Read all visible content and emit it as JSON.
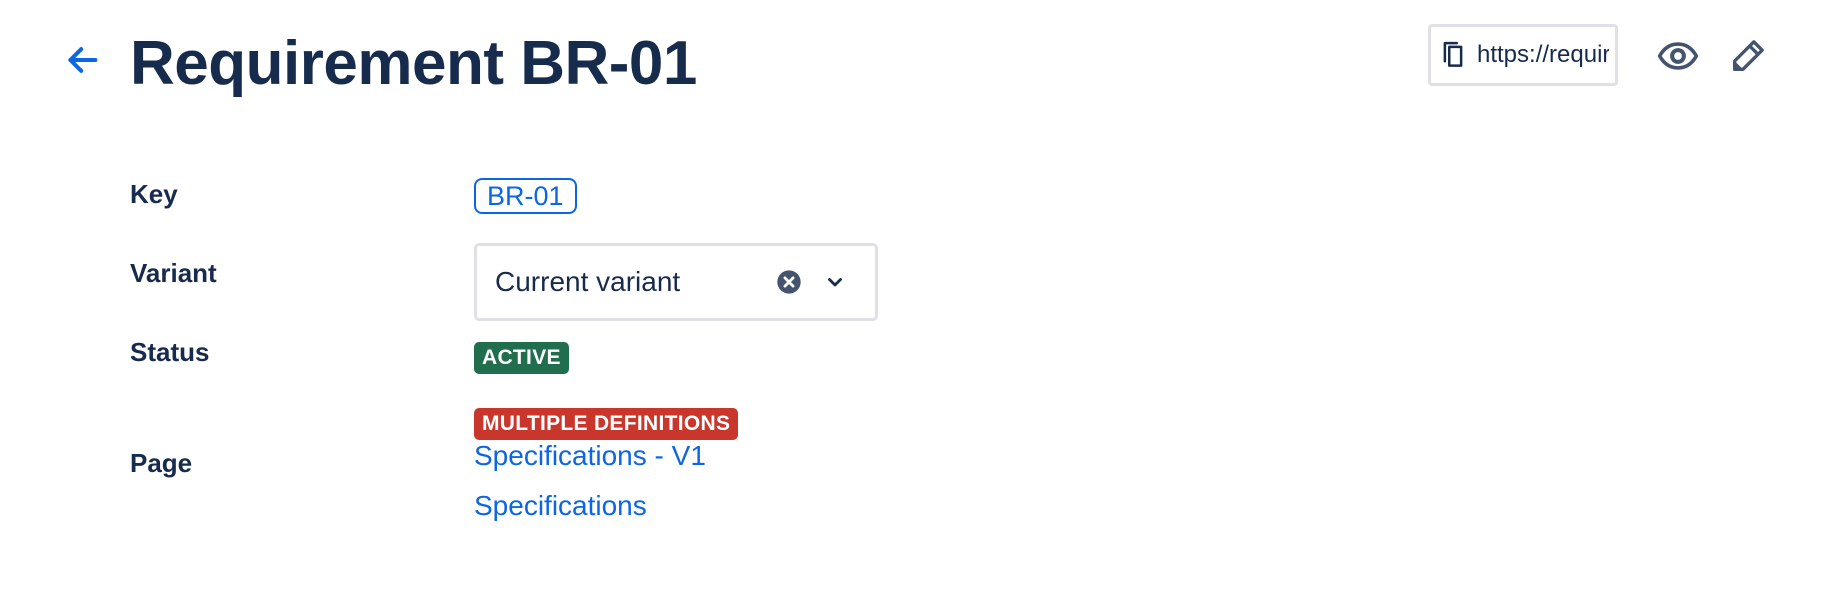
{
  "header": {
    "title": "Requirement BR-01",
    "url_value": "https://requirement"
  },
  "fields": {
    "key_label": "Key",
    "key_value": "BR-01",
    "variant_label": "Variant",
    "variant_value": "Current variant",
    "status_label": "Status",
    "status_value": "ACTIVE",
    "page_label": "Page",
    "page_warning": "MULTIPLE DEFINITIONS",
    "pages": [
      "Specifications - V1",
      "Specifications"
    ]
  },
  "colors": {
    "text": "#172b4d",
    "link": "#0c66e4",
    "status_active": "#216e4e",
    "warning": "#c9372c",
    "border": "#dfe1e6",
    "icon": "#44546f"
  },
  "icons": {
    "back": "arrow-left-icon",
    "copy": "copy-icon",
    "watch": "eye-icon",
    "edit": "pencil-icon",
    "clear": "clear-circle-icon",
    "dropdown": "chevron-down-icon"
  }
}
